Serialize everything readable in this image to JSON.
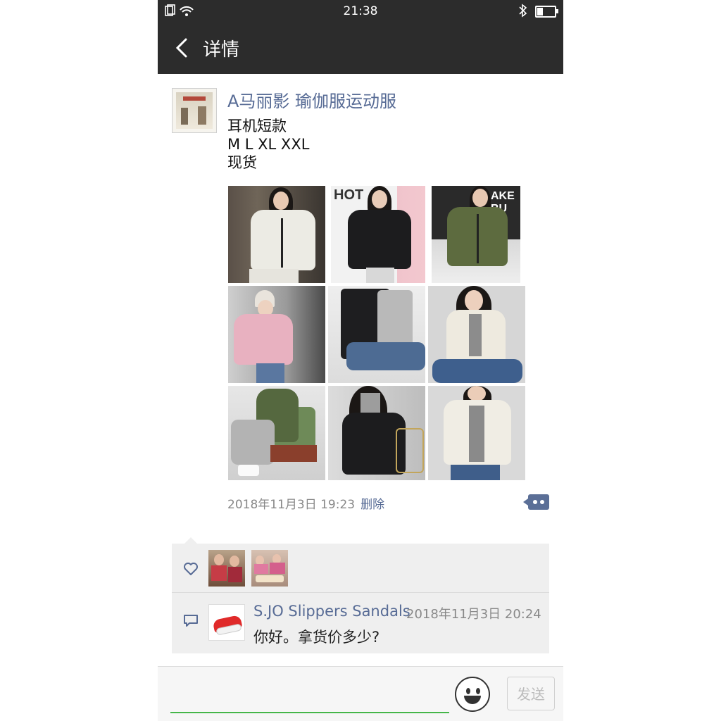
{
  "status_bar": {
    "time": "21:38",
    "battery_level": 0.35
  },
  "header": {
    "title": "详情"
  },
  "post": {
    "author": "A马丽影  瑜伽服运动服",
    "text_lines": [
      "耳机短款",
      "M L XL XXL",
      "现货"
    ],
    "photo_count": 9,
    "timestamp": "2018年11月3日 19:23",
    "delete_label": "删除"
  },
  "likes": {
    "count": 2
  },
  "comment": {
    "author": "S.JO Slippers Sandals",
    "time": "2018年11月3日 20:24",
    "text": "你好。拿货价多少?"
  },
  "input": {
    "placeholder": "",
    "value": ""
  },
  "send_label": "发送",
  "colors": {
    "accent_link": "#576b95",
    "bar_dark": "#2c2c2c",
    "input_underline": "#45b649"
  },
  "icons": [
    "back-icon",
    "heart-icon",
    "comment-icon",
    "emoji-icon",
    "bluetooth-icon",
    "wifi-icon",
    "battery-icon"
  ]
}
